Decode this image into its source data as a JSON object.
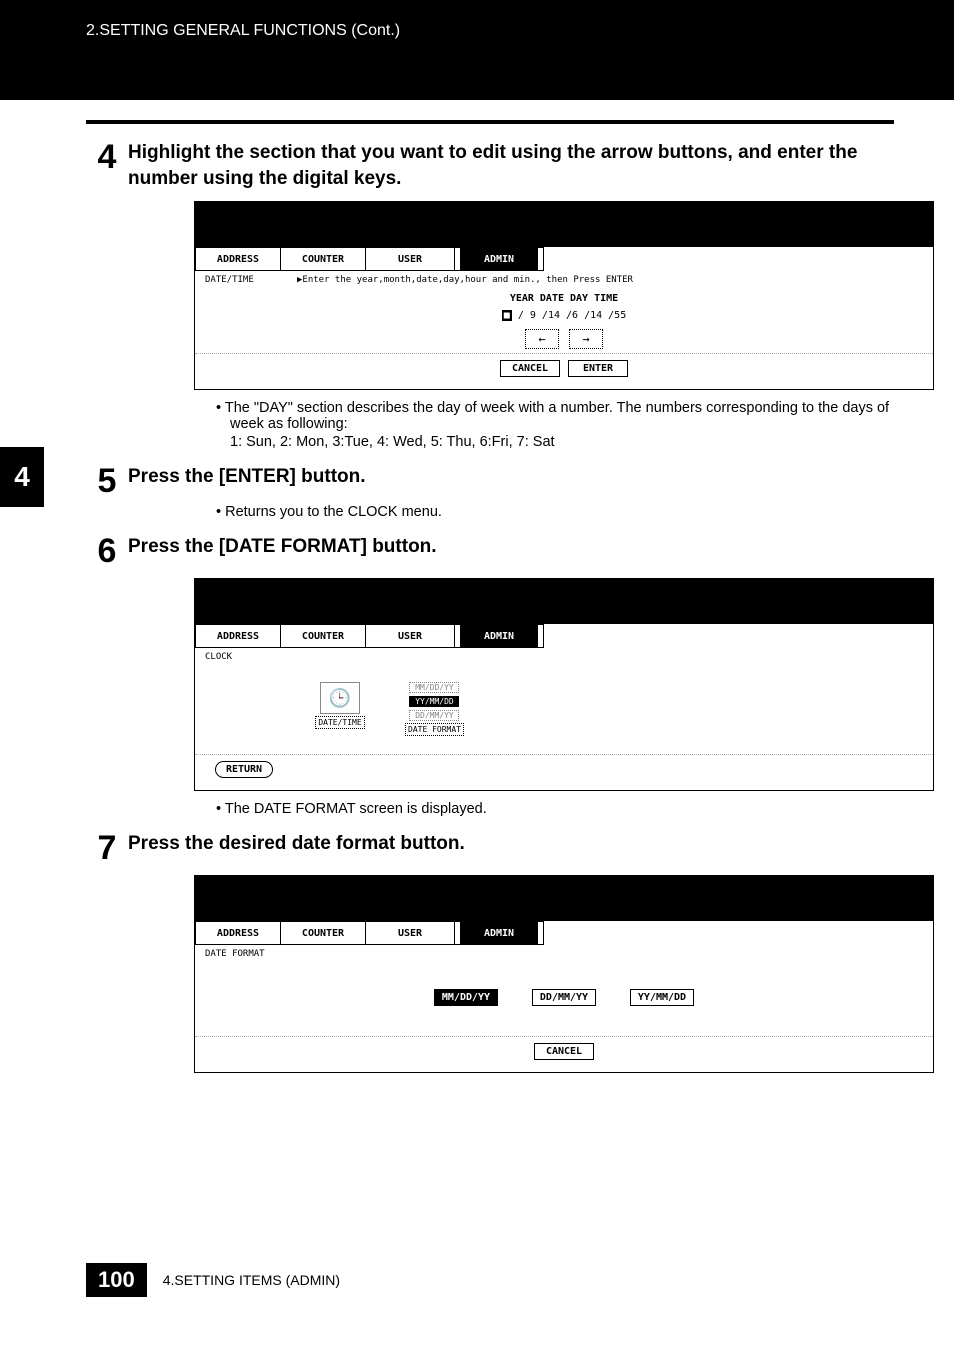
{
  "header": {
    "breadcrumb": "2.SETTING GENERAL FUNCTIONS (Cont.)"
  },
  "side_tab": "4",
  "steps": {
    "s4": {
      "num": "4",
      "title": "Highlight the section that you want to edit using the arrow buttons, and enter the number using the digital keys."
    },
    "s5": {
      "num": "5",
      "title": "Press the [ENTER] button."
    },
    "s6": {
      "num": "6",
      "title": "Press the [DATE FORMAT] button."
    },
    "s7": {
      "num": "7",
      "title": "Press the desired date format button."
    }
  },
  "notes": {
    "day_desc": "The \"DAY\" section describes the day of week with a number.  The numbers corresponding to the days of week as following:",
    "day_map": "1: Sun, 2: Mon, 3:Tue, 4: Wed, 5: Thu, 6:Fri, 7: Sat",
    "return_clock": "Returns you to the CLOCK menu.",
    "date_fmt_shown": "The DATE FORMAT screen is displayed."
  },
  "tabs": {
    "address": "ADDRESS",
    "counter": "COUNTER",
    "user": "USER",
    "admin": "ADMIN"
  },
  "screen1": {
    "label": "DATE/TIME",
    "hint": "▶Enter the year,month,date,day,hour and min., then Press ENTER",
    "cols": "YEAR  DATE  DAY  TIME",
    "vals_prefix": "■",
    "vals": "/ 9 /14 /6  /14 /55",
    "arrow_left": "←",
    "arrow_right": "→",
    "cancel": "CANCEL",
    "enter": "ENTER"
  },
  "screen2": {
    "label": "CLOCK",
    "icon_datetime": "DATE/TIME",
    "icon_datefmt": "DATE FORMAT",
    "opt1": "MM/DD/YY",
    "opt2": "YY/MM/DD",
    "opt3": "DD/MM/YY",
    "return": "RETURN"
  },
  "screen3": {
    "label": "DATE FORMAT",
    "opt1": "MM/DD/YY",
    "opt2": "DD/MM/YY",
    "opt3": "YY/MM/DD",
    "cancel": "CANCEL"
  },
  "footer": {
    "page": "100",
    "chapter": "4.SETTING ITEMS (ADMIN)"
  }
}
